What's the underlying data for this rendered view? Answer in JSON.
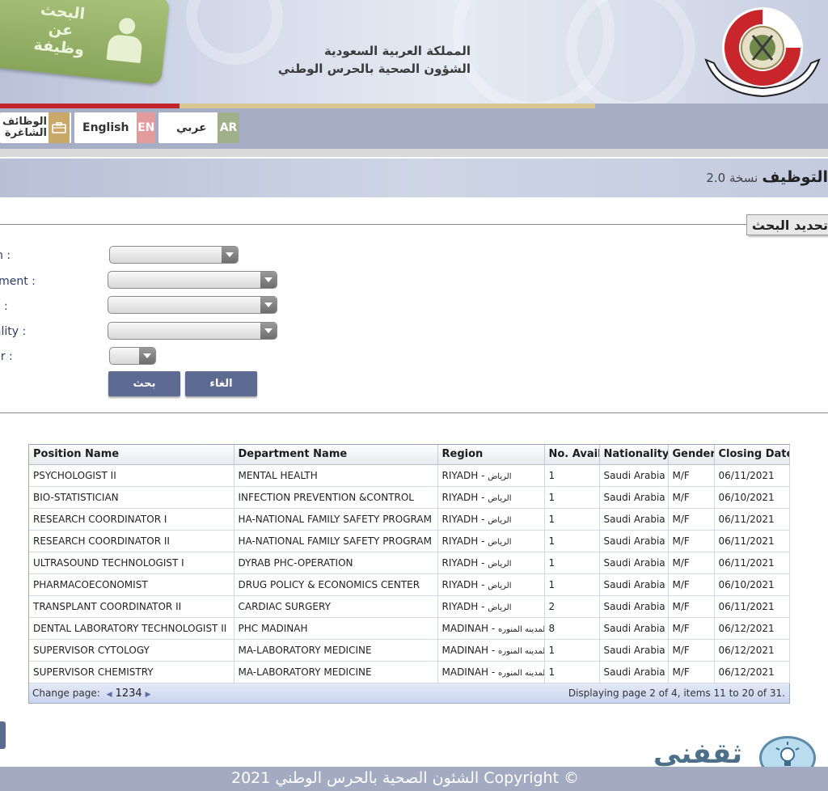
{
  "header": {
    "tile_text": "البحث عن وظيفة",
    "org_line1": "المملكة العربية السعودية",
    "org_line2": "الشؤون الصحية بالحرس الوطني"
  },
  "nav": {
    "vacancies_label": "الوظائف الشاغرة",
    "english_label": "English",
    "english_code": "EN",
    "arabic_label": "عربي",
    "arabic_code": "AR"
  },
  "page_title": {
    "main": "التوظيف",
    "version": "نسخة 2.0"
  },
  "search": {
    "section_title": "تحديد البحث",
    "fields": [
      "Region :",
      "Department :",
      "Position :",
      "Nationality :",
      "Gender :"
    ],
    "search_button": "بحث",
    "cancel_button": "الغاء"
  },
  "table": {
    "columns": [
      "Position Name",
      "Department Name",
      "Region",
      "No. Avail",
      "Nationality",
      "Gender",
      "Closing Date"
    ],
    "rows": [
      [
        "PSYCHOLOGIST II",
        "MENTAL HEALTH",
        "RIYADH - ",
        "الرياض",
        "1",
        "Saudi Arabia",
        "M/F",
        "06/11/2021"
      ],
      [
        "BIO-STATISTICIAN",
        "INFECTION PREVENTION &CONTROL",
        "RIYADH - ",
        "الرياض",
        "1",
        "Saudi Arabia",
        "M/F",
        "06/10/2021"
      ],
      [
        "RESEARCH COORDINATOR I",
        "HA-NATIONAL FAMILY SAFETY PROGRAM",
        "RIYADH - ",
        "الرياض",
        "1",
        "Saudi Arabia",
        "M/F",
        "06/11/2021"
      ],
      [
        "RESEARCH COORDINATOR II",
        "HA-NATIONAL FAMILY SAFETY PROGRAM",
        "RIYADH - ",
        "الرياض",
        "1",
        "Saudi Arabia",
        "M/F",
        "06/11/2021"
      ],
      [
        "ULTRASOUND TECHNOLOGIST I",
        "DYRAB PHC-OPERATION",
        "RIYADH - ",
        "الرياض",
        "1",
        "Saudi Arabia",
        "M/F",
        "06/11/2021"
      ],
      [
        "PHARMACOECONOMIST",
        "DRUG POLICY & ECONOMICS CENTER",
        "RIYADH - ",
        "الرياض",
        "1",
        "Saudi Arabia",
        "M/F",
        "06/10/2021"
      ],
      [
        "TRANSPLANT COORDINATOR II",
        "CARDIAC SURGERY",
        "RIYADH - ",
        "الرياض",
        "2",
        "Saudi Arabia",
        "M/F",
        "06/11/2021"
      ],
      [
        "DENTAL LABORATORY TECHNOLOGIST II",
        "PHC MADINAH",
        "MADINAH - ",
        "المدينه المنوره",
        "8",
        "Saudi Arabia",
        "M/F",
        "06/12/2021"
      ],
      [
        "SUPERVISOR CYTOLOGY",
        "MA-LABORATORY MEDICINE",
        "MADINAH - ",
        "المدينه المنوره",
        "1",
        "Saudi Arabia",
        "M/F",
        "06/12/2021"
      ],
      [
        "SUPERVISOR CHEMISTRY",
        "MA-LABORATORY MEDICINE",
        "MADINAH - ",
        "المدينه المنوره",
        "1",
        "Saudi Arabia",
        "M/F",
        "06/12/2021"
      ]
    ],
    "pager": {
      "change_page_label": "Change page:",
      "pages": [
        "1",
        "2",
        "3",
        "4"
      ],
      "summary": "Displaying page 2 of 4, items 11 to 20 of 31."
    }
  },
  "watermark_text": "ثقفني",
  "footer": {
    "copyright": "الشئون الصحية بالحرس الوطني 2021 Copyright ©"
  },
  "colors": {
    "accent_navy": "#5d6b92",
    "navbar": "#a6aec6",
    "stripe_red": "#c4262e",
    "stripe_gold": "#d8c592",
    "en_code_bg": "#e39a9a",
    "ar_code_bg": "#9fb08a",
    "vacancies_icon_bg": "#c8a96a"
  }
}
